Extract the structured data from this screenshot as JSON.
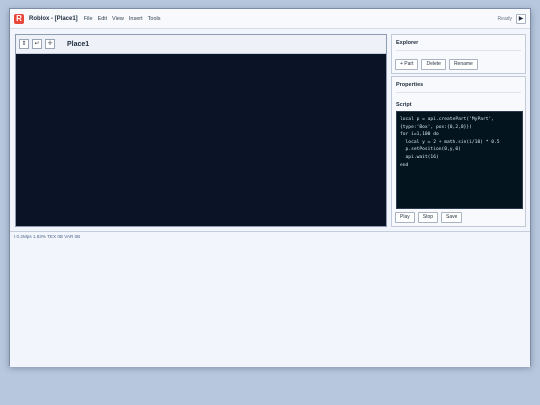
{
  "titlebar": {
    "logo_letter": "R",
    "title": "Roblox - [Place1]",
    "menu": [
      "File",
      "Edit",
      "View",
      "Insert",
      "Tools"
    ],
    "status": "Ready",
    "play_glyph": "▶"
  },
  "viewport": {
    "tools": [
      {
        "icon": "move-vertical-icon",
        "glyph": "⇕"
      },
      {
        "icon": "rotate-icon",
        "glyph": "↵"
      },
      {
        "icon": "crosshair-icon",
        "glyph": "✛"
      }
    ],
    "place_title": "Place1"
  },
  "explorer": {
    "title": "Explorer",
    "buttons": {
      "add_part": "+ Part",
      "delete": "Delete",
      "rename": "Rename"
    }
  },
  "properties": {
    "title": "Properties",
    "script_label": "Script",
    "code": "local p = api.createPart('MyPart',\n{type:'Box', pos:{0,2,0}})\nfor i=1,100 do\n  local y = 2 + math.sin(i/10) * 0.5\n  p.setPosition(0,y,0)\n  api.wait(16)\nend",
    "buttons": {
      "play": "Play",
      "stop": "Stop",
      "save": "Save"
    }
  },
  "statusbar": {
    "text": "t 0.2Mps 1.63% TEX 0B VAR 0B"
  }
}
